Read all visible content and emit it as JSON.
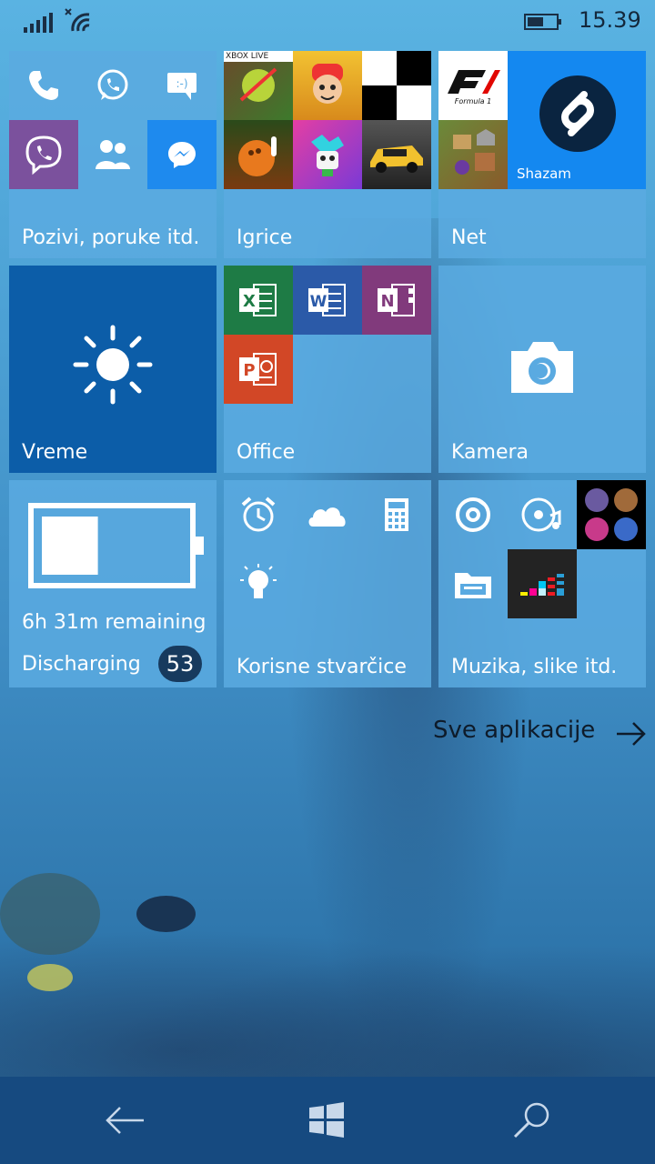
{
  "status_bar": {
    "time": "15.39",
    "signal_icon": "signal-bars-icon",
    "wifi_icon": "wifi-icon",
    "battery_icon": "battery-icon"
  },
  "tiles": {
    "communication": {
      "label": "Pozivi, poruke itd.",
      "icons": [
        "phone-icon",
        "whatsapp-icon",
        "messaging-icon",
        "viber-icon",
        "people-icon",
        "messenger-icon"
      ]
    },
    "games": {
      "label": "Igrice",
      "xbox_live": "XBOX LIVE",
      "icons": [
        "fruit-ninja-icon",
        "subway-surfers-icon",
        "piano-tiles-icon",
        "bowling-icon",
        "jump-game-icon",
        "racing-car-icon"
      ]
    },
    "net": {
      "label": "Net",
      "shazam_label": "Shazam",
      "f1_text": "Formula 1",
      "icons": [
        "f1-icon",
        "clash-of-clans-icon",
        "shazam-icon"
      ]
    },
    "weather": {
      "label": "Vreme",
      "icon": "sun-icon"
    },
    "office": {
      "label": "Office",
      "apps": [
        {
          "letter": "X",
          "icon": "excel-icon"
        },
        {
          "letter": "W",
          "icon": "word-icon"
        },
        {
          "letter": "N",
          "icon": "onenote-icon"
        },
        {
          "letter": "P",
          "icon": "powerpoint-icon"
        }
      ]
    },
    "camera": {
      "label": "Kamera",
      "icon": "camera-icon"
    },
    "battery": {
      "remaining": "6h 31m remaining",
      "state": "Discharging",
      "percent": "53",
      "fill_fraction": 0.4
    },
    "utilities": {
      "label": "Korisne stvarčice",
      "icons": [
        "alarm-clock-icon",
        "onedrive-icon",
        "calculator-icon",
        "lightbulb-icon"
      ]
    },
    "media": {
      "label": "Muzika, slike itd.",
      "icons": [
        "groove-music-icon",
        "music-disc-icon",
        "album-art-icon",
        "file-explorer-icon",
        "deezer-icon"
      ]
    }
  },
  "all_apps": {
    "label": "Sve aplikacije",
    "icon": "arrow-right-icon"
  },
  "nav_bar": {
    "back_icon": "back-arrow-icon",
    "start_icon": "windows-logo-icon",
    "search_icon": "search-icon"
  }
}
